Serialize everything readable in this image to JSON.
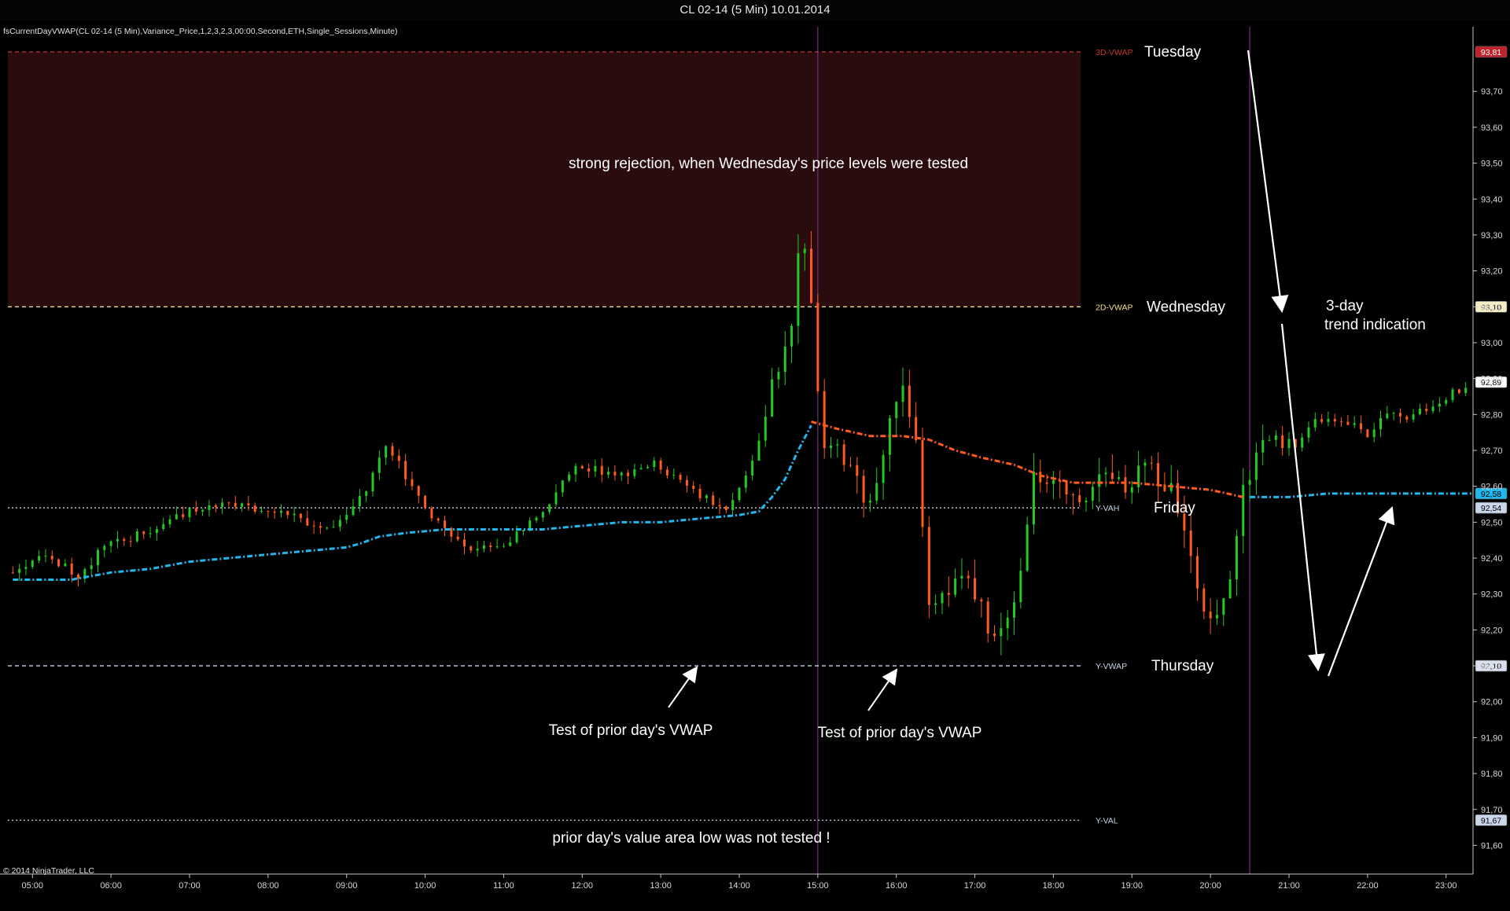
{
  "window": {
    "title": "CL 02-14 (5 Min)  10.01.2014"
  },
  "indicator_label": "fsCurrentDayVWAP(CL 02-14 (5 Min),Variance_Price,1,2,3,2,3,00:00,Second,ETH,Single_Sessions,Minute)",
  "copyright": "© 2014 NinjaTrader, LLC",
  "colors": {
    "background": "#000000",
    "up_candle": "#22c922",
    "down_candle": "#ff5a1f",
    "vwap": "#20b6ee",
    "prior_vwap": "#ff5a1f",
    "zone": "#2a0b0e",
    "session_line": "#7c2a82",
    "level_3d": "#c0392b",
    "level_2d": "#f0e08c",
    "level_y": "#c9d4e6"
  },
  "chart_data": {
    "type": "candlestick",
    "instrument": "CL 02-14",
    "interval": "5 Min",
    "date": "10.01.2014",
    "ylim": [
      91.52,
      93.88
    ],
    "yticks": [
      "93,70",
      "93,60",
      "93,50",
      "93,40",
      "93,30",
      "93,20",
      "93,10",
      "93,00",
      "92,90",
      "92,80",
      "92,70",
      "92,60",
      "92,50",
      "92,40",
      "92,30",
      "92,20",
      "92,10",
      "92,00",
      "91,90",
      "91,80",
      "91,70",
      "91,60"
    ],
    "xlim": [
      "04:40",
      "23:20"
    ],
    "xticks": [
      "05:00",
      "06:00",
      "07:00",
      "08:00",
      "09:00",
      "10:00",
      "11:00",
      "12:00",
      "13:00",
      "14:00",
      "15:00",
      "16:00",
      "17:00",
      "18:00",
      "19:00",
      "20:00",
      "21:00",
      "22:00",
      "23:00"
    ],
    "session_lines": [
      "15:00",
      "20:30"
    ],
    "shaded_zone": {
      "from": 93.1,
      "to": 93.81
    },
    "levels": [
      {
        "label": "3D-VWAP",
        "value": 93.81,
        "badge": "93,81",
        "style": "dashed",
        "color": "#c0392b"
      },
      {
        "label": "2D-VWAP",
        "value": 93.1,
        "badge": "93,10",
        "style": "dashed",
        "color": "#f0e08c"
      },
      {
        "label": "Y-VAH",
        "value": 92.54,
        "badge": "92,54",
        "style": "dotted",
        "color": "#c9d4e6"
      },
      {
        "label": "Y-VWAP",
        "value": 92.1,
        "badge": "92,10",
        "style": "dashed",
        "color": "#c9d4e6"
      },
      {
        "label": "Y-VAL",
        "value": 91.67,
        "badge": "91,67",
        "style": "dotted",
        "color": "#c9d4e6"
      }
    ],
    "price_badges": [
      {
        "value": 92.89,
        "text": "92,89",
        "bg": "#ffffff",
        "fg": "#000000"
      },
      {
        "value": 92.58,
        "text": "92,58",
        "bg": "#20b6ee",
        "fg": "#000000"
      }
    ],
    "vwap_series": [
      [
        "04:45",
        92.34
      ],
      [
        "05:30",
        92.34
      ],
      [
        "06:00",
        92.36
      ],
      [
        "06:30",
        92.37
      ],
      [
        "07:00",
        92.39
      ],
      [
        "07:30",
        92.4
      ],
      [
        "08:00",
        92.41
      ],
      [
        "08:30",
        92.42
      ],
      [
        "09:00",
        92.43
      ],
      [
        "09:10",
        92.44
      ],
      [
        "09:25",
        92.46
      ],
      [
        "09:45",
        92.47
      ],
      [
        "10:15",
        92.48
      ],
      [
        "10:45",
        92.48
      ],
      [
        "11:30",
        92.48
      ],
      [
        "12:00",
        92.49
      ],
      [
        "12:30",
        92.5
      ],
      [
        "13:00",
        92.5
      ],
      [
        "13:30",
        92.51
      ],
      [
        "14:00",
        92.52
      ],
      [
        "14:15",
        92.53
      ],
      [
        "14:25",
        92.57
      ],
      [
        "14:35",
        92.62
      ],
      [
        "14:45",
        92.7
      ],
      [
        "14:55",
        92.77
      ]
    ],
    "prior_vwap_series": [
      [
        "14:55",
        92.78
      ],
      [
        "15:15",
        92.76
      ],
      [
        "15:40",
        92.74
      ],
      [
        "16:05",
        92.74
      ],
      [
        "16:25",
        92.73
      ],
      [
        "16:45",
        92.7
      ],
      [
        "17:05",
        92.68
      ],
      [
        "17:30",
        92.66
      ],
      [
        "17:50",
        92.63
      ],
      [
        "18:15",
        92.61
      ],
      [
        "19:00",
        92.61
      ],
      [
        "19:30",
        92.6
      ],
      [
        "20:00",
        92.59
      ],
      [
        "20:25",
        92.57
      ]
    ],
    "vwap_series_2": [
      [
        "20:30",
        92.57
      ],
      [
        "21:00",
        92.57
      ],
      [
        "21:30",
        92.58
      ],
      [
        "22:00",
        92.58
      ],
      [
        "22:30",
        92.58
      ],
      [
        "23:00",
        92.58
      ],
      [
        "23:20",
        92.58
      ]
    ],
    "candles_anchor": [
      [
        "04:45",
        92.36
      ],
      [
        "05:15",
        92.41
      ],
      [
        "05:40",
        92.35
      ],
      [
        "06:00",
        92.43
      ],
      [
        "06:30",
        92.47
      ],
      [
        "07:00",
        92.52
      ],
      [
        "07:30",
        92.56
      ],
      [
        "08:00",
        92.53
      ],
      [
        "08:30",
        92.51
      ],
      [
        "08:50",
        92.48
      ],
      [
        "09:20",
        92.58
      ],
      [
        "09:35",
        92.72
      ],
      [
        "09:55",
        92.6
      ],
      [
        "10:10",
        92.52
      ],
      [
        "10:25",
        92.47
      ],
      [
        "10:40",
        92.42
      ],
      [
        "11:00",
        92.43
      ],
      [
        "11:20",
        92.48
      ],
      [
        "11:40",
        92.56
      ],
      [
        "12:00",
        92.66
      ],
      [
        "12:30",
        92.63
      ],
      [
        "13:00",
        92.66
      ],
      [
        "13:30",
        92.59
      ],
      [
        "13:55",
        92.53
      ],
      [
        "14:15",
        92.66
      ],
      [
        "14:30",
        92.88
      ],
      [
        "14:45",
        93.02
      ],
      [
        "14:52",
        93.34
      ],
      [
        "15:00",
        93.1
      ],
      [
        "15:08",
        92.72
      ],
      [
        "15:30",
        92.66
      ],
      [
        "15:45",
        92.54
      ],
      [
        "16:00",
        92.76
      ],
      [
        "16:10",
        92.89
      ],
      [
        "16:20",
        92.7
      ],
      [
        "16:30",
        92.24
      ],
      [
        "16:45",
        92.32
      ],
      [
        "17:00",
        92.35
      ],
      [
        "17:20",
        92.16
      ],
      [
        "17:35",
        92.28
      ],
      [
        "17:50",
        92.62
      ],
      [
        "18:15",
        92.58
      ],
      [
        "18:30",
        92.57
      ],
      [
        "18:45",
        92.65
      ],
      [
        "19:00",
        92.61
      ],
      [
        "19:20",
        92.65
      ],
      [
        "19:35",
        92.59
      ],
      [
        "19:55",
        92.34
      ],
      [
        "20:05",
        92.22
      ],
      [
        "20:20",
        92.34
      ],
      [
        "20:30",
        92.6
      ],
      [
        "20:45",
        92.73
      ],
      [
        "21:10",
        92.72
      ],
      [
        "21:25",
        92.79
      ],
      [
        "21:50",
        92.78
      ],
      [
        "22:05",
        92.74
      ],
      [
        "22:20",
        92.8
      ],
      [
        "22:35",
        92.78
      ],
      [
        "22:55",
        92.83
      ],
      [
        "23:15",
        92.87
      ]
    ],
    "annotations": [
      {
        "text": "strong rejection, when Wednesday's price levels were tested",
        "x": "15:55",
        "y": 93.49
      },
      {
        "text": "Test of prior day's VWAP",
        "x": "15:20",
        "y": 91.92
      },
      {
        "text": "Test of prior day's VWAP",
        "x": "20:05",
        "y": 91.92
      },
      {
        "text": "prior day's value area low was not tested !",
        "x": "16:00",
        "y": 91.63
      }
    ],
    "day_labels": [
      {
        "text": "Tuesday",
        "value": 93.81
      },
      {
        "text": "Wednesday",
        "value": 93.1
      },
      {
        "text": "Friday",
        "value": 92.54
      },
      {
        "text": "Thursday",
        "value": 92.1
      }
    ],
    "trend_label": [
      "3-day",
      "trend indication"
    ]
  }
}
